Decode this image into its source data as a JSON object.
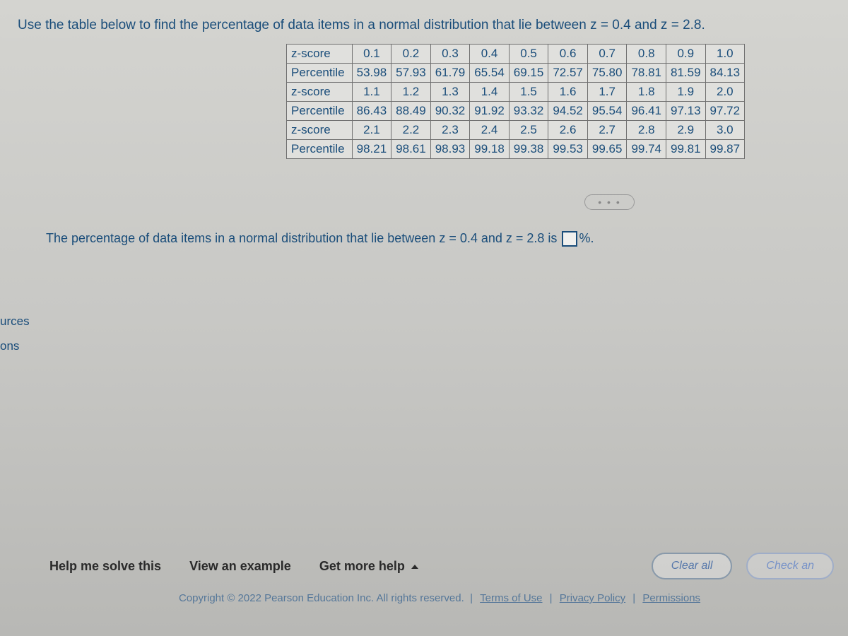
{
  "problem": "Use the table below to find the percentage of data items in a normal distribution that lie between z = 0.4 and z = 2.8.",
  "table": {
    "zLabel": "z-score",
    "pLabel": "Percentile",
    "rows": [
      {
        "z": [
          "0.1",
          "0.2",
          "0.3",
          "0.4",
          "0.5",
          "0.6",
          "0.7",
          "0.8",
          "0.9",
          "1.0"
        ],
        "p": [
          "53.98",
          "57.93",
          "61.79",
          "65.54",
          "69.15",
          "72.57",
          "75.80",
          "78.81",
          "81.59",
          "84.13"
        ]
      },
      {
        "z": [
          "1.1",
          "1.2",
          "1.3",
          "1.4",
          "1.5",
          "1.6",
          "1.7",
          "1.8",
          "1.9",
          "2.0"
        ],
        "p": [
          "86.43",
          "88.49",
          "90.32",
          "91.92",
          "93.32",
          "94.52",
          "95.54",
          "96.41",
          "97.13",
          "97.72"
        ]
      },
      {
        "z": [
          "2.1",
          "2.2",
          "2.3",
          "2.4",
          "2.5",
          "2.6",
          "2.7",
          "2.8",
          "2.9",
          "3.0"
        ],
        "p": [
          "98.21",
          "98.61",
          "98.93",
          "99.18",
          "99.38",
          "99.53",
          "99.65",
          "99.74",
          "99.81",
          "99.87"
        ]
      }
    ]
  },
  "dots": "• • •",
  "answer": {
    "prefix": "The percentage of data items in a normal distribution that lie between z = 0.4 and z = 2.8 is",
    "suffix": "%."
  },
  "sidebar": {
    "item1": "urces",
    "item2": "ons"
  },
  "bottom": {
    "help": "Help me solve this",
    "example": "View an example",
    "moreHelp": "Get more help",
    "clearAll": "Clear all",
    "checkAnswer": "Check an"
  },
  "footer": {
    "copyright": "Copyright © 2022 Pearson Education Inc. All rights reserved.",
    "terms": "Terms of Use",
    "privacy": "Privacy Policy",
    "permissions": "Permissions"
  }
}
